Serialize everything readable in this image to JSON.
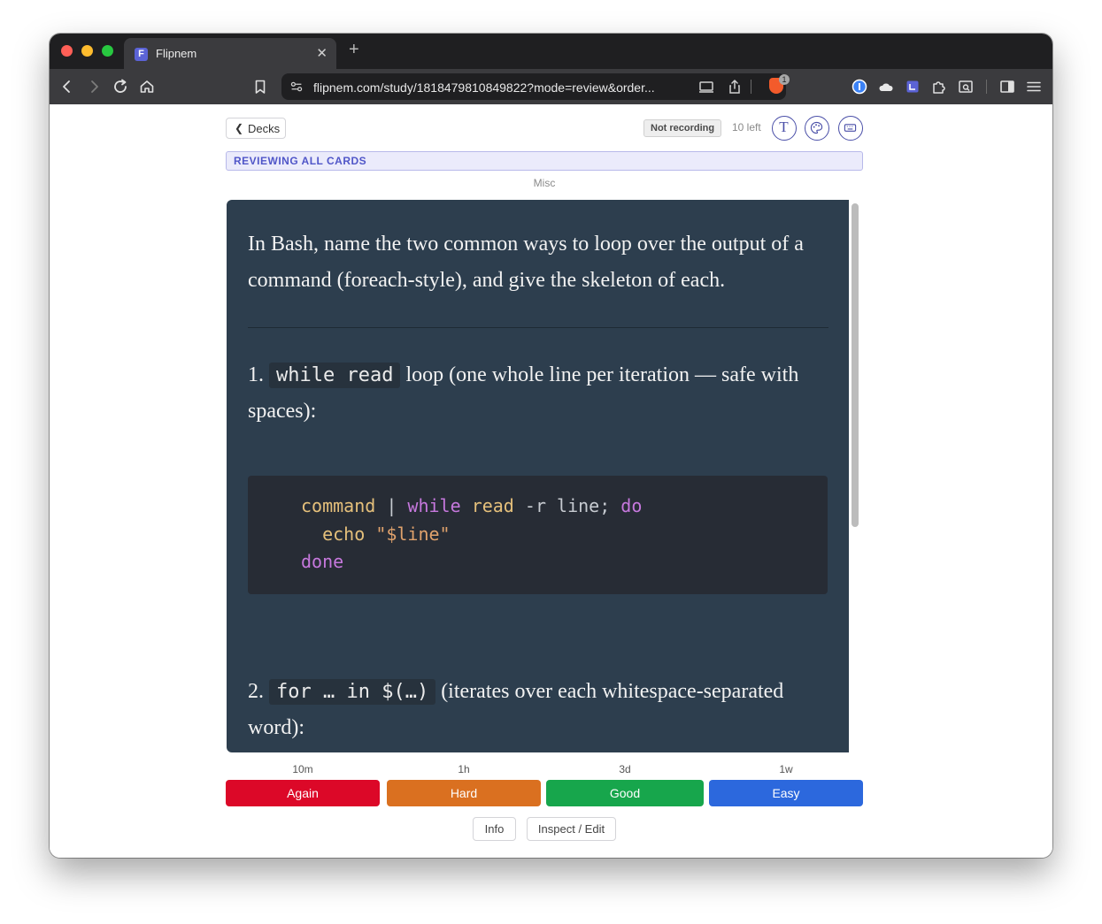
{
  "browser": {
    "tab": {
      "favicon": "F",
      "title": "Flipnem",
      "close": "✕"
    },
    "new_tab": "+",
    "url": "flipnem.com/study/1818479810849822?mode=review&order...",
    "brave_shield_count": "1"
  },
  "header": {
    "back_label": "Decks",
    "recording_status": "Not recording",
    "cards_left": "10 left",
    "text_button_glyph": "T"
  },
  "banner": "REVIEWING ALL CARDS",
  "deck_name": "Misc",
  "card": {
    "question": "In Bash, name the two common ways to loop over the output of a command (foreach-style), and give the skeleton of each.",
    "item1": {
      "number": "1.",
      "code": "while read",
      "text": "loop (one whole line per iteration — safe with spaces):"
    },
    "code_block": {
      "line1": {
        "cmd": "command",
        "pipe": " | ",
        "kw1": "while",
        "read": "read",
        "rest": " -r line; ",
        "kw2": "do"
      },
      "line2": {
        "indent": "  ",
        "echo": "echo",
        "space": " ",
        "str": "\"$line\""
      },
      "line3": {
        "kw": "done"
      }
    },
    "item2": {
      "number": "2.",
      "code": "for … in $(…)",
      "text": "(iterates over each whitespace-separated word):"
    }
  },
  "grades": [
    {
      "label": "Again",
      "interval": "10m",
      "color": "#dc0828"
    },
    {
      "label": "Hard",
      "interval": "1h",
      "color": "#da7020"
    },
    {
      "label": "Good",
      "interval": "3d",
      "color": "#17a64c"
    },
    {
      "label": "Easy",
      "interval": "1w",
      "color": "#2c68dd"
    }
  ],
  "footer": {
    "info_label": "Info",
    "inspect_label": "Inspect / Edit"
  },
  "icons": [
    "back-icon",
    "forward-icon",
    "reload-icon",
    "home-icon",
    "bookmark-icon",
    "site-settings-icon",
    "cast-icon",
    "share-icon",
    "brave-shield-icon",
    "password-manager-icon",
    "cloud-extension-icon",
    "ext-app-icon",
    "extensions-puzzle-icon",
    "screenshot-icon",
    "sidebar-icon",
    "menu-icon",
    "text-style-icon",
    "palette-icon",
    "keyboard-icon"
  ]
}
